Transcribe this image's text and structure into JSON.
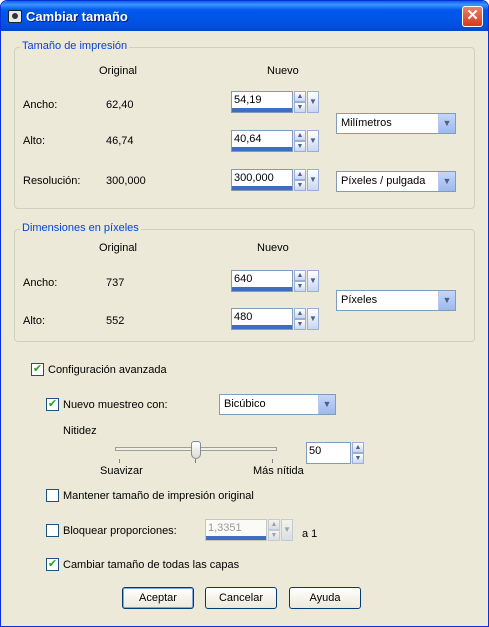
{
  "window": {
    "title": "Cambiar tamaño",
    "close_glyph": "✕",
    "icon": "app-icon"
  },
  "print_size": {
    "legend": "Tamaño de impresión",
    "col_original": "Original",
    "col_new": "Nuevo",
    "width_label": "Ancho:",
    "width_original": "62,40",
    "width_new": "54,19",
    "height_label": "Alto:",
    "height_original": "46,74",
    "height_new": "40,64",
    "resolution_label": "Resolución:",
    "resolution_original": "300,000",
    "resolution_new": "300,000",
    "unit_selected": "Milímetros",
    "resolution_unit_selected": "Píxeles / pulgada"
  },
  "pixel_dims": {
    "legend": "Dimensiones en píxeles",
    "col_original": "Original",
    "col_new": "Nuevo",
    "width_label": "Ancho:",
    "width_original": "737",
    "width_new": "640",
    "height_label": "Alto:",
    "height_original": "552",
    "height_new": "480",
    "unit_selected": "Píxeles"
  },
  "advanced": {
    "advanced_label": "Configuración avanzada",
    "advanced_checked": true,
    "resample_label": "Nuevo muestreo con:",
    "resample_checked": true,
    "resample_method": "Bicúbico",
    "sharpness_label": "Nitidez",
    "sharpness_value": "50",
    "slider_min_label": "Suavizar",
    "slider_max_label": "Más nítida",
    "slider_level": 0.5,
    "keep_print_size_label": "Mantener tamaño de impresión original",
    "keep_print_size_checked": false,
    "lock_ratio_label": "Bloquear proporciones:",
    "lock_ratio_checked": false,
    "ratio_value": "1,3351",
    "ratio_suffix": "a 1",
    "all_layers_label": "Cambiar tamaño de todas las capas",
    "all_layers_checked": true
  },
  "buttons": {
    "ok": "Aceptar",
    "cancel": "Cancelar",
    "help": "Ayuda"
  },
  "glyphs": {
    "check": "✔",
    "up": "▲",
    "down": "▼"
  },
  "colors": {
    "title_bar": "#0054e3",
    "legend_text": "#0046d5",
    "close_button": "#d6391a",
    "check_mark": "#21a121"
  }
}
